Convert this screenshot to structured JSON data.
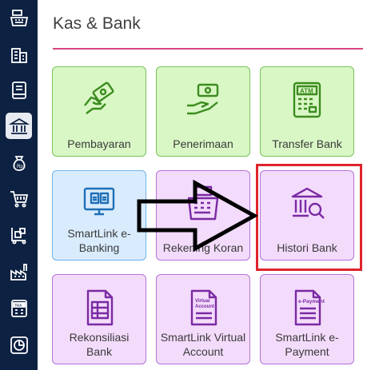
{
  "page": {
    "title": "Kas & Bank"
  },
  "sidebar": {
    "items": [
      {
        "icon": "cash-register-icon"
      },
      {
        "icon": "building-icon"
      },
      {
        "icon": "book-icon"
      },
      {
        "icon": "bank-icon",
        "active": true
      },
      {
        "icon": "money-bag-icon"
      },
      {
        "icon": "shopping-cart-icon"
      },
      {
        "icon": "delivery-cart-icon"
      },
      {
        "icon": "factory-icon"
      },
      {
        "icon": "tax-icon"
      },
      {
        "icon": "pie-chart-icon"
      }
    ]
  },
  "tiles": [
    {
      "label": "Pembayaran",
      "color": "green",
      "icon": "hand-money-icon"
    },
    {
      "label": "Penerimaan",
      "color": "green",
      "icon": "receive-money-icon"
    },
    {
      "label": "Transfer Bank",
      "color": "green",
      "icon": "atm-icon"
    },
    {
      "label": "SmartLink e-Banking",
      "color": "blue",
      "icon": "smartlink-ebanking-icon"
    },
    {
      "label": "Rekening Koran",
      "color": "purple",
      "icon": "cash-register-icon"
    },
    {
      "label": "Histori Bank",
      "color": "purple",
      "icon": "bank-search-icon"
    },
    {
      "label": "Rekonsiliasi Bank",
      "color": "purple",
      "icon": "document-icon"
    },
    {
      "label": "SmartLink Virtual Account",
      "color": "purple",
      "icon": "virtual-account-icon",
      "icon_text": "Virtual Account"
    },
    {
      "label": "SmartLink e-Payment",
      "color": "purple",
      "icon": "epayment-icon",
      "icon_text": "e-Payment"
    }
  ],
  "colors": {
    "sidebar": "#0d2142",
    "accent_rule": "#d6457f",
    "green_icon": "#3c8c1f",
    "blue_icon": "#1f6fb6",
    "purple_icon": "#7a2aa3",
    "highlight": "#e0232d"
  }
}
